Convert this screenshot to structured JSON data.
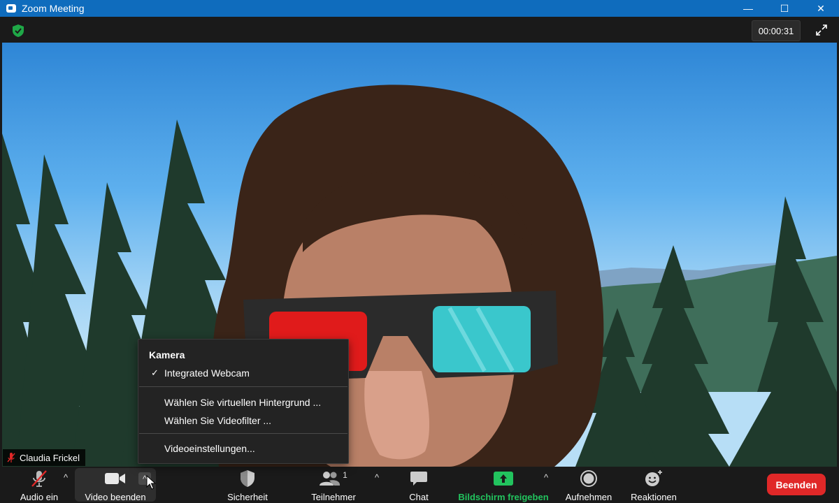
{
  "window": {
    "title": "Zoom Meeting",
    "minimize": "—",
    "maximize": "☐",
    "close": "✕"
  },
  "topbar": {
    "timer": "00:00:31"
  },
  "participant": {
    "name": "Claudia Frickel"
  },
  "camera_menu": {
    "header": "Kamera",
    "selected_camera": "Integrated Webcam",
    "items": [
      "Wählen Sie virtuellen Hintergrund ...",
      "Wählen Sie Videofilter ...",
      "Videoeinstellungen..."
    ]
  },
  "toolbar": {
    "audio": "Audio ein",
    "video": "Video beenden",
    "security": "Sicherheit",
    "participants": "Teilnehmer",
    "participants_count": "1",
    "chat": "Chat",
    "share": "Bildschirm freigeben",
    "record": "Aufnehmen",
    "reactions": "Reaktionen",
    "end": "Beenden"
  },
  "colors": {
    "titlebar": "#0f6cbd",
    "share_green": "#22c35e",
    "end_red": "#e02828",
    "muted_red": "#e02828"
  }
}
